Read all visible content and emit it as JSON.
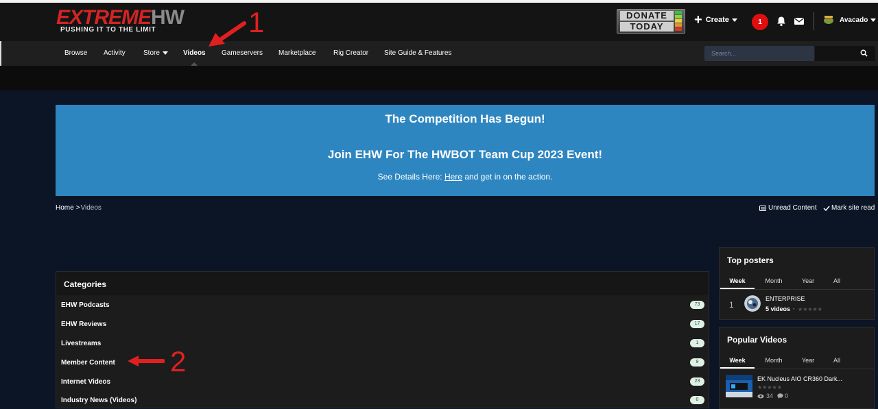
{
  "header": {
    "logo_main_a": "EXTREME",
    "logo_main_b": "HW",
    "logo_tagline": "PUSHING IT TO THE LIMIT",
    "donate_line1": "DONATE",
    "donate_line2": "TODAY",
    "create_label": "Create",
    "notification_count": "1",
    "username": "Avacado"
  },
  "annotations": {
    "marker_1": "1",
    "marker_2": "2",
    "arrow_color": "#e02020"
  },
  "nav": {
    "items": [
      {
        "label": "Browse"
      },
      {
        "label": "Activity"
      },
      {
        "label": "Store"
      },
      {
        "label": "Videos"
      },
      {
        "label": "Gameservers"
      },
      {
        "label": "Marketplace"
      },
      {
        "label": "Rig Creator"
      },
      {
        "label": "Site Guide & Features"
      }
    ],
    "search_placeholder": "Search..."
  },
  "banner": {
    "heading1": "The Competition Has Begun!",
    "heading2": "Join EHW For The HWBOT Team Cup 2023 Event!",
    "text_before": "See Details Here: ",
    "link_text": "Here",
    "text_after": " and get in on the action.",
    "color": "#2e86c1"
  },
  "breadcrumb": {
    "home": "Home",
    "separator": ">",
    "current": "Videos"
  },
  "actions": {
    "unread": "Unread Content",
    "mark_read": "Mark site read"
  },
  "categories": {
    "title": "Categories",
    "items": [
      {
        "name": "EHW Podcasts",
        "count": "73"
      },
      {
        "name": "EHW Reviews",
        "count": "17"
      },
      {
        "name": "Livestreams",
        "count": "1"
      },
      {
        "name": "Member Content",
        "count": "9"
      },
      {
        "name": "Internet Videos",
        "count": "23"
      },
      {
        "name": "Industry News (Videos)",
        "count": "0"
      }
    ]
  },
  "top_posters": {
    "title": "Top posters",
    "tabs": [
      "Week",
      "Month",
      "Year",
      "All"
    ],
    "entries": [
      {
        "rank": "1",
        "name": "ENTERPRISE",
        "videos": "5 videos",
        "dot": "·"
      }
    ]
  },
  "popular_videos": {
    "title": "Popular Videos",
    "tabs": [
      "Week",
      "Month",
      "Year",
      "All"
    ],
    "entries": [
      {
        "title": "EK Nucleus AIO CR360 Dark...",
        "views": "34",
        "comments": "0"
      }
    ]
  }
}
